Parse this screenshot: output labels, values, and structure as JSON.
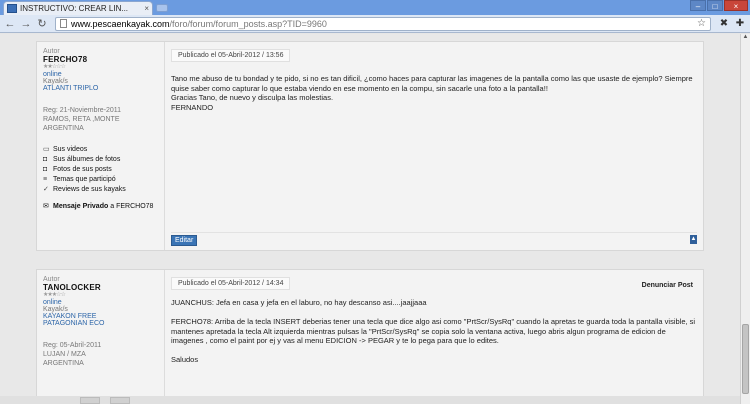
{
  "browser": {
    "tab_title": "INSTRUCTIVO: CREAR LIN...",
    "tab_close": "×",
    "url_host": "www.pescaenkayak.com",
    "url_path": "/foro/forum/forum_posts.asp?TID=9960",
    "icons": [
      "back-icon",
      "forward-icon",
      "reload-icon",
      "star-icon",
      "wrench-icon",
      "tools-icon"
    ]
  },
  "posts": [
    {
      "author_label": "Autor",
      "author": "FERCHO78",
      "stars": "★★☆☆☆",
      "status": "online",
      "kayak_label": "Kayak/s",
      "kayak": "ATLANTI TRIPLO",
      "reg": "Reg: 21-Noviembre-2011",
      "location1": "RAMOS, RETA ,MONTE",
      "location2": "ARGENTINA",
      "links": [
        "Sus videos",
        "Sus álbumes de fotos",
        "Fotos de sus posts",
        "Temas que participó",
        "Reviews de sus kayaks"
      ],
      "pm_bold": "Mensaje Privado",
      "pm_rest": "a FERCHO78",
      "date": "Publicado el 05-Abril-2012 / 13:56",
      "text": "Tano me abuso de tu bondad y te pido, si no es tan dificil, ¿como haces para capturar las imagenes de la pantalla como las que usaste de ejemplo? Siempre quise saber como capturar lo que estaba viendo en ese momento en la compu, sin sacarle una foto a la pantalla!!\nGracias Tano, de nuevo y disculpa las molestias.\nFERNANDO",
      "edit_label": "Editar"
    },
    {
      "author_label": "Autor",
      "author": "TANOLOCKER",
      "stars": "★★★☆☆",
      "status": "online",
      "kayak_label": "Kayak/s",
      "kayak": "KAYAKON FREE\nPATAGONIAN ECO",
      "reg": "Reg: 05-Abril-2011",
      "location1": "LUJAN / MZA",
      "location2": "ARGENTINA",
      "date": "Publicado el 05-Abril-2012 / 14:34",
      "report": "Denunciar Post",
      "text": "JUANCHUS: Jefa en casa y jefa en el laburo, no hay descanso asi....jaajjaaa\n\nFERCHO78: Arriba de la tecla INSERT deberias tener una tecla que dice algo asi como \"PrtScr/SysRq\" cuando la apretas te guarda toda la pantalla visible, si mantenes apretada la tecla Alt izquierda mientras pulsas la \"PrtScr/SysRq\" se copia solo la ventana activa, luego abris algun programa de edicion de imagenes , como el paint por ej y vas al menu EDICION -> PEGAR y te lo pega para que lo edites.\n\nSaludos"
    }
  ]
}
